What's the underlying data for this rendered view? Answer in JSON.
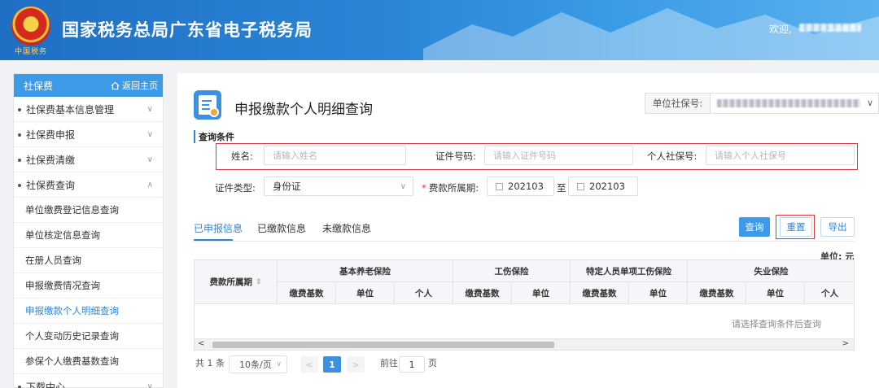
{
  "header": {
    "site_title": "国家税务总局广东省电子税务局",
    "emblem_caption": "中国税务",
    "welcome": "欢迎,"
  },
  "sidebar": {
    "title": "社保费",
    "home_link": "返回主页",
    "items": [
      {
        "label": "社保费基本信息管理",
        "type": "group",
        "expanded": false
      },
      {
        "label": "社保费申报",
        "type": "group",
        "expanded": false
      },
      {
        "label": "社保费清缴",
        "type": "group",
        "expanded": false
      },
      {
        "label": "社保费查询",
        "type": "group",
        "expanded": true
      },
      {
        "label": "单位缴费登记信息查询",
        "type": "sub"
      },
      {
        "label": "单位核定信息查询",
        "type": "sub"
      },
      {
        "label": "在册人员查询",
        "type": "sub"
      },
      {
        "label": "申报缴费情况查询",
        "type": "sub"
      },
      {
        "label": "申报缴款个人明细查询",
        "type": "sub",
        "active": true
      },
      {
        "label": "个人变动历史记录查询",
        "type": "sub"
      },
      {
        "label": "参保个人缴费基数查询",
        "type": "sub"
      },
      {
        "label": "下载中心",
        "type": "group",
        "expanded": false
      }
    ]
  },
  "main": {
    "page_title": "申报缴款个人明细查询",
    "unit_label": "单位社保号:",
    "section_label": "查询条件",
    "filters": {
      "name_label": "姓名:",
      "name_placeholder": "请输入姓名",
      "id_label": "证件号码:",
      "id_placeholder": "请输入证件号码",
      "ss_label": "个人社保号:",
      "ss_placeholder": "请输入个人社保号",
      "id_type_label": "证件类型:",
      "id_type_value": "身份证",
      "period_label": "费款所属期:",
      "period_from": "202103",
      "period_sep": "至",
      "period_to": "202103"
    },
    "tabs": [
      "已申报信息",
      "已缴款信息",
      "未缴款信息"
    ],
    "active_tab": 0,
    "buttons": {
      "query": "查询",
      "reset": "重置",
      "export": "导出"
    },
    "unit_note": "单位: 元",
    "table": {
      "period_header": "费款所属期",
      "groups": [
        "基本养老保险",
        "工伤保险",
        "特定人员单项工伤保险",
        "失业保险"
      ],
      "subheaders": [
        "缴费基数",
        "单位",
        "个人",
        "缴费基数",
        "单位",
        "缴费基数",
        "单位",
        "缴费基数",
        "单位",
        "个人"
      ],
      "empty_text": "请选择查询条件后查询"
    },
    "pager": {
      "total": "共 1 条",
      "page_size": "10条/页",
      "current_page": "1",
      "goto_label": "前往",
      "goto_value": "1",
      "page_suffix": "页"
    }
  }
}
